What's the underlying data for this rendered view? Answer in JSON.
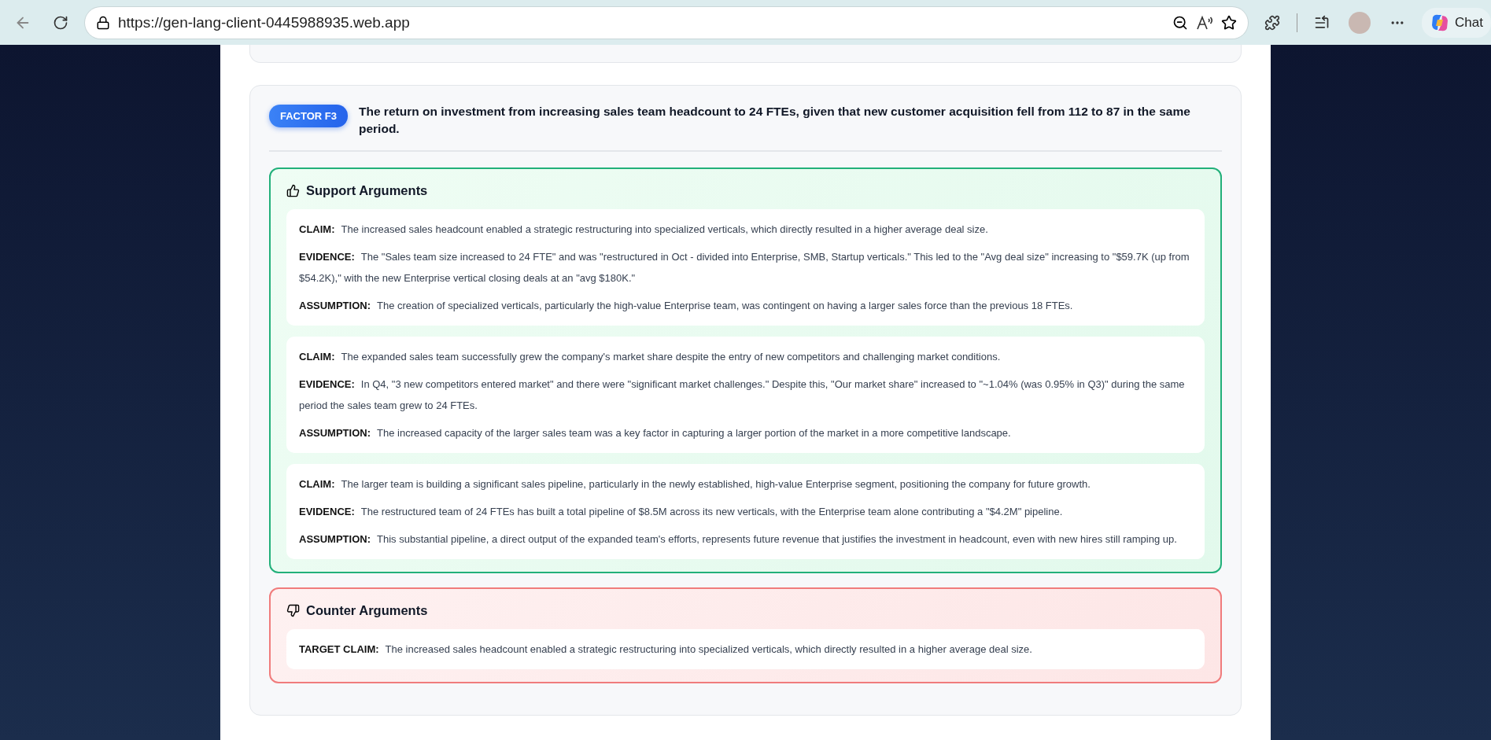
{
  "browser": {
    "url": "https://gen-lang-client-0445988935.web.app",
    "chat_label": "Chat"
  },
  "factor": {
    "badge": "FACTOR F3",
    "title": "The return on investment from increasing sales team headcount to 24 FTEs, given that new customer acquisition fell from 112 to 87 in the same period."
  },
  "sections": [
    {
      "kind": "support",
      "title": "Support Arguments",
      "arguments": [
        {
          "fields": [
            {
              "label": "CLAIM:",
              "text": "The increased sales headcount enabled a strategic restructuring into specialized verticals, which directly resulted in a higher average deal size."
            },
            {
              "label": "EVIDENCE:",
              "text": "The \"Sales team size increased to 24 FTE\" and was \"restructured in Oct - divided into Enterprise, SMB, Startup verticals.\" This led to the \"Avg deal size\" increasing to \"$59.7K (up from $54.2K),\" with the new Enterprise vertical closing deals at an \"avg $180K.\""
            },
            {
              "label": "ASSUMPTION:",
              "text": "The creation of specialized verticals, particularly the high-value Enterprise team, was contingent on having a larger sales force than the previous 18 FTEs."
            }
          ]
        },
        {
          "fields": [
            {
              "label": "CLAIM:",
              "text": "The expanded sales team successfully grew the company's market share despite the entry of new competitors and challenging market conditions."
            },
            {
              "label": "EVIDENCE:",
              "text": "In Q4, \"3 new competitors entered market\" and there were \"significant market challenges.\" Despite this, \"Our market share\" increased to \"~1.04% (was 0.95% in Q3)\" during the same period the sales team grew to 24 FTEs."
            },
            {
              "label": "ASSUMPTION:",
              "text": "The increased capacity of the larger sales team was a key factor in capturing a larger portion of the market in a more competitive landscape."
            }
          ]
        },
        {
          "fields": [
            {
              "label": "CLAIM:",
              "text": "The larger team is building a significant sales pipeline, particularly in the newly established, high-value Enterprise segment, positioning the company for future growth."
            },
            {
              "label": "EVIDENCE:",
              "text": "The restructured team of 24 FTEs has built a total pipeline of $8.5M across its new verticals, with the Enterprise team alone contributing a \"$4.2M\" pipeline."
            },
            {
              "label": "ASSUMPTION:",
              "text": "This substantial pipeline, a direct output of the expanded team's efforts, represents future revenue that justifies the investment in headcount, even with new hires still ramping up."
            }
          ]
        }
      ]
    },
    {
      "kind": "counter",
      "title": "Counter Arguments",
      "arguments": [
        {
          "fields": [
            {
              "label": "TARGET CLAIM:",
              "text": "The increased sales headcount enabled a strategic restructuring into specialized verticals, which directly resulted in a higher average deal size."
            }
          ]
        }
      ]
    }
  ]
}
